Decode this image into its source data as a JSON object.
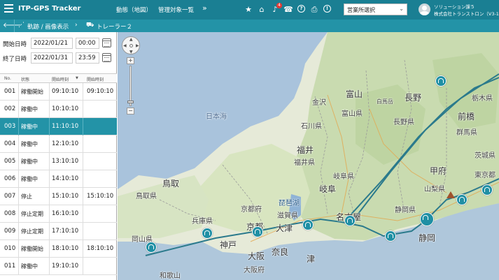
{
  "header": {
    "app_title": "ITP-GPS Tracker",
    "menu_map": "動態（地図）",
    "menu_targets": "管理対象一覧",
    "menu_more": "»",
    "notification_count": "4",
    "help_glyph": "?",
    "info_glyph": "!",
    "office_select_value": "営業所選択",
    "user_department": "ソリューション課５",
    "user_company": "株式会社トランストロン（V3-19）"
  },
  "breadcrumb": {
    "item1": "軌跡 / 画像表示",
    "item2": "トレーラー２"
  },
  "range": {
    "start_label": "開始日時",
    "start_date": "2022/01/21",
    "start_time": "00:00",
    "end_label": "終了日時",
    "end_date": "2022/01/31",
    "end_time": "23:59"
  },
  "table": {
    "headers": {
      "no": "No.",
      "status": "状態",
      "start_time": "開始時刻",
      "sort_glyph": "▼",
      "end_time": "開始時刻"
    },
    "rows": [
      {
        "no": "001",
        "status": "稼働開始",
        "t1": "09:10:10",
        "t2": "09:10:10"
      },
      {
        "no": "002",
        "status": "稼働中",
        "t1": "10:10:10",
        "t2": ""
      },
      {
        "no": "003",
        "status": "稼働中",
        "t1": "11:10:10",
        "t2": ""
      },
      {
        "no": "004",
        "status": "稼働中",
        "t1": "12:10:10",
        "t2": ""
      },
      {
        "no": "005",
        "status": "稼働中",
        "t1": "13:10:10",
        "t2": ""
      },
      {
        "no": "006",
        "status": "稼働中",
        "t1": "14:10:10",
        "t2": ""
      },
      {
        "no": "007",
        "status": "停止",
        "t1": "15:10:10",
        "t2": "15:10:10"
      },
      {
        "no": "008",
        "status": "停止定期",
        "t1": "16:10:10",
        "t2": ""
      },
      {
        "no": "009",
        "status": "停止定期",
        "t1": "17:10:10",
        "t2": ""
      },
      {
        "no": "010",
        "status": "稼働開始",
        "t1": "18:10:10",
        "t2": "18:10:10"
      },
      {
        "no": "011",
        "status": "稼働中",
        "t1": "19:10:10",
        "t2": ""
      }
    ]
  },
  "map": {
    "labels": {
      "sea": "日本海",
      "l1": "金沢",
      "l2": "富山",
      "l3": "富山県",
      "l4": "石川県",
      "l5": "福井",
      "l6": "福井県",
      "l7": "白馬岳",
      "l8": "長野",
      "l9": "長野県",
      "l10": "前橋",
      "l11": "群馬県",
      "l12": "岐阜県",
      "l13": "岐阜",
      "l14": "甲府",
      "l15": "山梨県",
      "l16": "鳥取県",
      "l17": "鳥取",
      "l18": "京都府",
      "l19": "滋賀県",
      "l20": "琵琶湖",
      "l21": "兵庫県",
      "l22": "京都",
      "l23": "大津",
      "l24": "名古屋",
      "l25": "静岡県",
      "l26": "静岡",
      "l27": "岡山県",
      "l28": "神戸",
      "l29": "大阪",
      "l30": "奈良",
      "l31": "大阪府",
      "l32": "津",
      "l33": "東京都",
      "l34": "茨城県",
      "l35": "栃木県",
      "l36": "和歌山"
    },
    "zoom_in": "+",
    "zoom_out": "−"
  },
  "colors": {
    "header": "#1a7f93",
    "crumb": "#2393a7",
    "selected": "#2393a7",
    "route": "#2b7a8c"
  }
}
